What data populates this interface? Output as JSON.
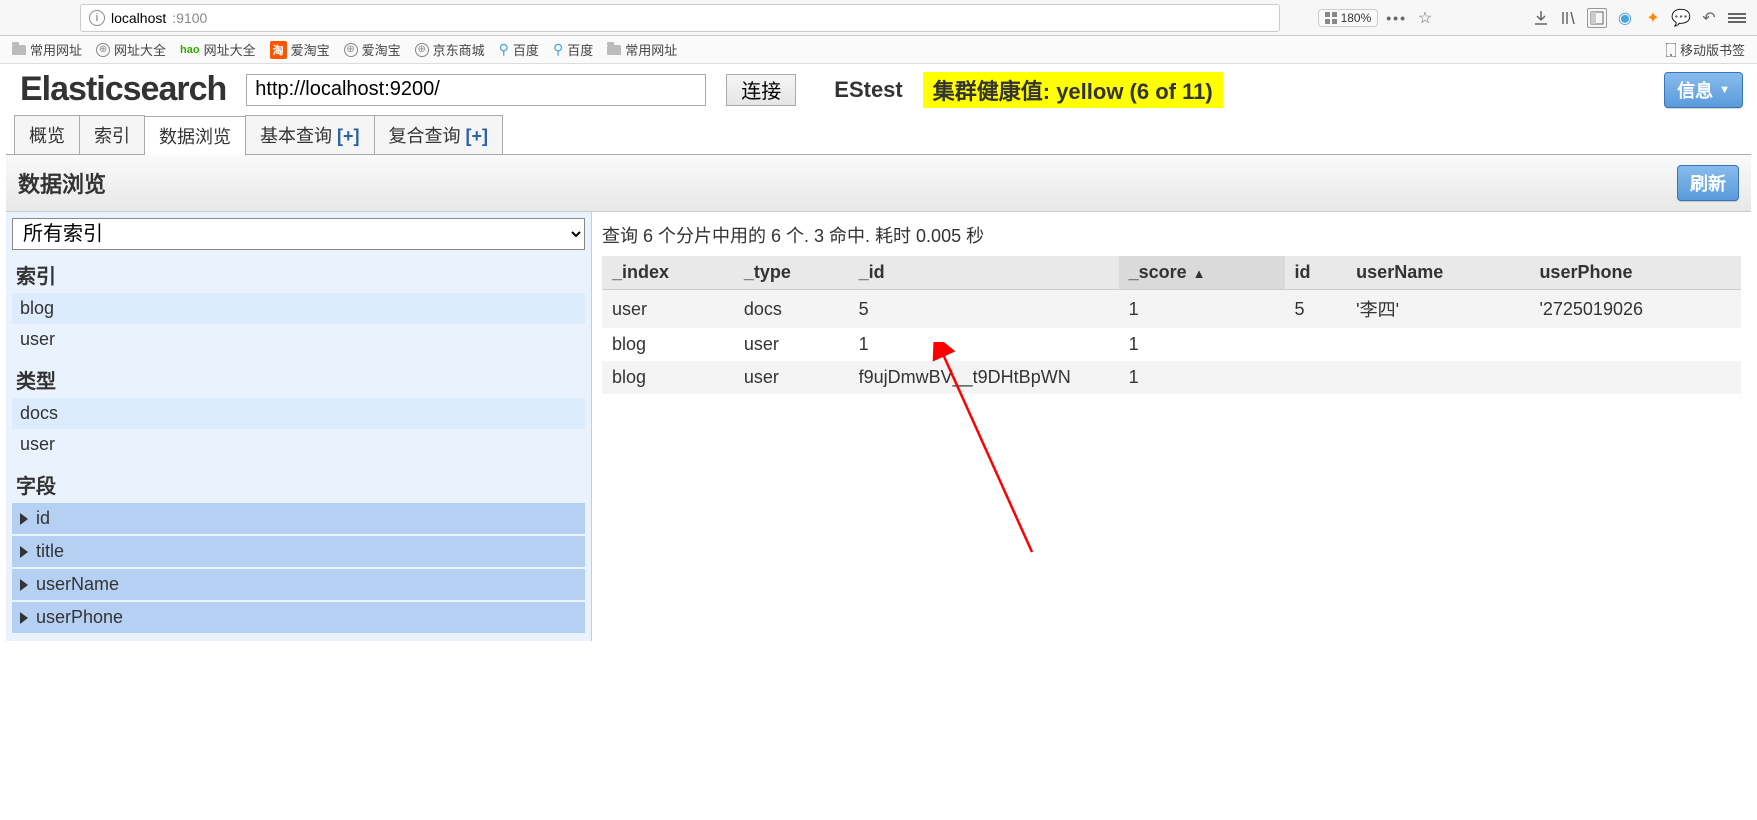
{
  "browser": {
    "url_host": "localhost",
    "url_port": ":9100",
    "zoom": "180%",
    "mobile_bookmark": "移动版书签"
  },
  "bookmarks": [
    "常用网址",
    "网址大全",
    "网址大全",
    "爱淘宝",
    "爱淘宝",
    "京东商城",
    "百度",
    "百度",
    "常用网址"
  ],
  "header": {
    "app_title": "Elasticsearch",
    "conn_url": "http://localhost:9200/",
    "connect_label": "连接",
    "cluster_name": "EStest",
    "health": "集群健康值: yellow (6 of 11)",
    "info_label": "信息"
  },
  "tabs": [
    {
      "label": "概览",
      "plus": ""
    },
    {
      "label": "索引",
      "plus": ""
    },
    {
      "label": "数据浏览",
      "plus": ""
    },
    {
      "label": "基本查询",
      "plus": " [+]"
    },
    {
      "label": "复合查询",
      "plus": " [+]"
    }
  ],
  "active_tab_index": 2,
  "subheader": {
    "title": "数据浏览",
    "refresh": "刷新"
  },
  "left": {
    "index_select": "所有索引",
    "sect_index": "索引",
    "index_items": [
      "blog",
      "user"
    ],
    "sect_type": "类型",
    "type_items": [
      "docs",
      "user"
    ],
    "sect_field": "字段",
    "field_items": [
      "id",
      "title",
      "userName",
      "userPhone"
    ]
  },
  "right": {
    "summary": "查询 6 个分片中用的 6 个. 3 命中. 耗时 0.005 秒",
    "columns": [
      "_index",
      "_type",
      "_id",
      "_score",
      "id",
      "userName",
      "userPhone"
    ],
    "sort_col": "_score",
    "rows": [
      {
        "_index": "user",
        "_type": "docs",
        "_id": "5",
        "_score": "1",
        "id": "5",
        "userName": "'李四'",
        "userPhone": "'2725019026"
      },
      {
        "_index": "blog",
        "_type": "user",
        "_id": "1",
        "_score": "1",
        "id": "",
        "userName": "",
        "userPhone": ""
      },
      {
        "_index": "blog",
        "_type": "user",
        "_id": "f9ujDmwBV__t9DHtBpWN",
        "_score": "1",
        "id": "",
        "userName": "",
        "userPhone": ""
      }
    ]
  }
}
